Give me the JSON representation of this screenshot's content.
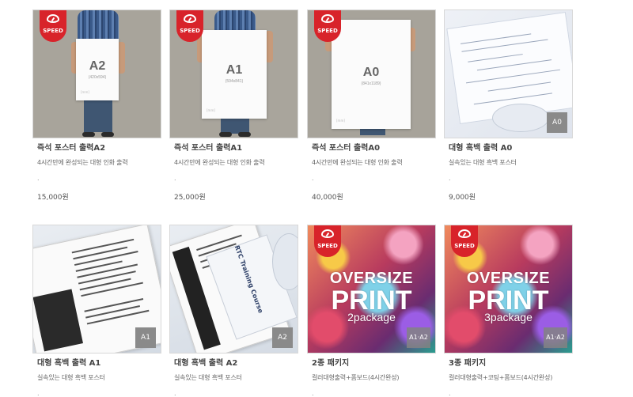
{
  "badge": {
    "speed_label": "SPEED",
    "speed_color": "#d8232a"
  },
  "products": [
    {
      "id": "p1",
      "title": "즉석 포스터 출력A2",
      "desc": "4시간만에 완성되는 대형 인화 출력",
      "dot": ".",
      "price": "15,000원",
      "poster_size": "A2",
      "poster_caption": "(420x594)",
      "poster_corner": "[mm]"
    },
    {
      "id": "p2",
      "title": "즉석 포스터 출력A1",
      "desc": "4시간만에 완성되는 대형 인화 출력",
      "dot": ".",
      "price": "25,000원",
      "poster_size": "A1",
      "poster_caption": "(594x841)",
      "poster_corner": "[mm]"
    },
    {
      "id": "p3",
      "title": "즉석 포스터 출력A0",
      "desc": "4시간만에 완성되는 대형 인화 출력",
      "dot": ".",
      "price": "40,000원",
      "poster_size": "A0",
      "poster_caption": "(841x1189)",
      "poster_corner": "[mm]"
    },
    {
      "id": "p4",
      "title": "대형 흑백 출력 A0",
      "desc": "실속있는 대형 흑백 포스터",
      "dot": ".",
      "price": "9,000원",
      "size_tag": "A0"
    },
    {
      "id": "p5",
      "title": "대형 흑백 출력 A1",
      "desc": "실속있는 대형 흑백 포스터",
      "dot": ".",
      "size_tag": "A1"
    },
    {
      "id": "p6",
      "title": "대형 흑백 출력 A2",
      "desc": "실속있는 대형 흑백 포스터",
      "dot": ".",
      "size_tag": "A2",
      "doc_heading": "RTC Training Course"
    },
    {
      "id": "p7",
      "title": "2종 패키지",
      "desc": "컬러대형출력+폼보드(4시간완성)",
      "dot": ".",
      "size_tag": "A1·A2",
      "ov_line1": "OVERSIZE",
      "ov_line2": "PRINT",
      "ov_line3": "2package"
    },
    {
      "id": "p8",
      "title": "3종 패키지",
      "desc": "컬러대형출력+코팅+폼보드(4시간완성)",
      "dot": ".",
      "size_tag": "A1·A2",
      "ov_line1": "OVERSIZE",
      "ov_line2": "PRINT",
      "ov_line3": "3package"
    }
  ]
}
